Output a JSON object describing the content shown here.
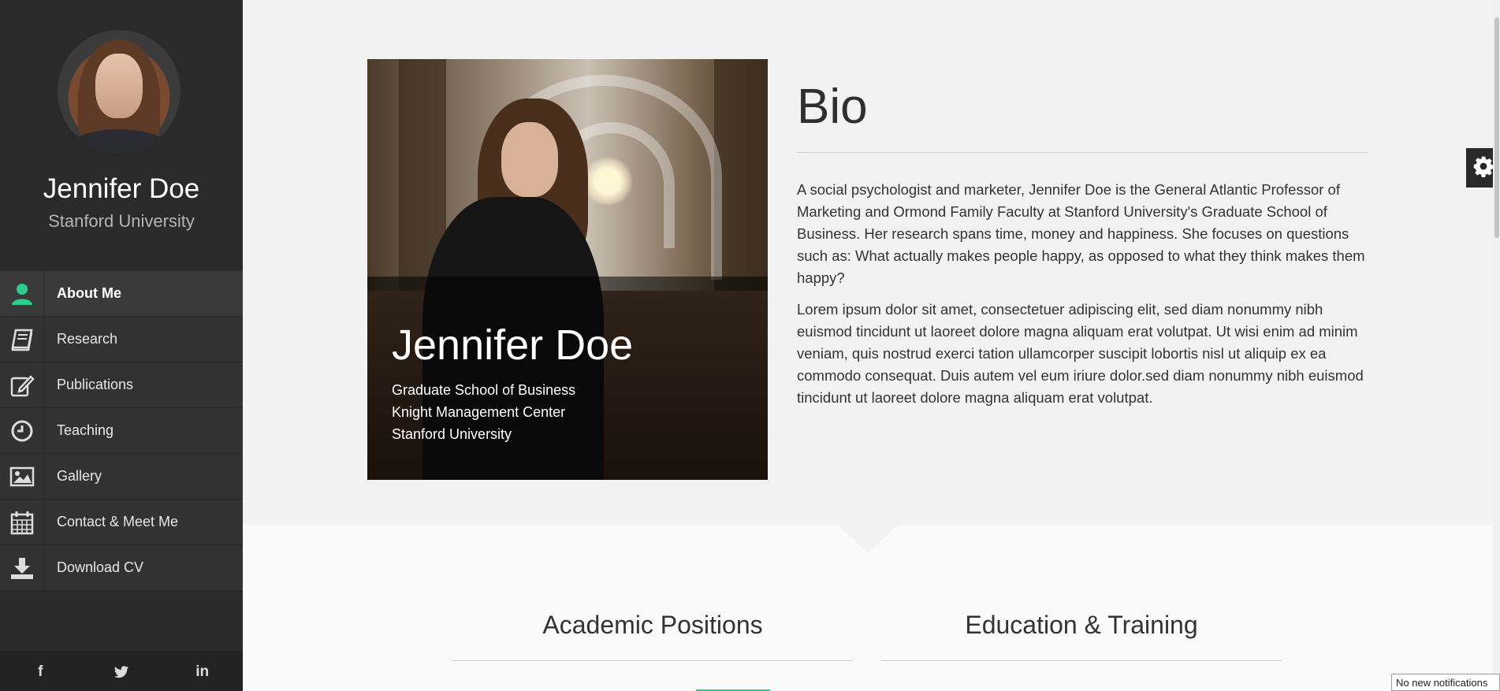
{
  "sidebar": {
    "name": "Jennifer Doe",
    "university": "Stanford University",
    "nav": [
      {
        "label": "About Me",
        "icon": "user-icon",
        "active": true
      },
      {
        "label": "Research",
        "icon": "book-icon"
      },
      {
        "label": "Publications",
        "icon": "edit-icon"
      },
      {
        "label": "Teaching",
        "icon": "clock-icon"
      },
      {
        "label": "Gallery",
        "icon": "image-icon"
      },
      {
        "label": "Contact & Meet Me",
        "icon": "calendar-icon"
      },
      {
        "label": "Download CV",
        "icon": "download-icon"
      }
    ],
    "social": [
      {
        "label": "f",
        "icon": "facebook-icon"
      },
      {
        "label": "🐦",
        "icon": "twitter-icon"
      },
      {
        "label": "in",
        "icon": "linkedin-icon"
      }
    ]
  },
  "profile_card": {
    "name": "Jennifer Doe",
    "lines": [
      "Graduate School of Business",
      "Knight Management Center",
      "Stanford University"
    ]
  },
  "bio": {
    "title": "Bio",
    "paragraphs": [
      "A social psychologist and marketer, Jennifer Doe is the General Atlantic Professor of Marketing and Ormond Family Faculty at Stanford University's Graduate School of Business. Her research spans time, money and happiness. She focuses on questions such as: What actually makes people happy, as opposed to what they think makes them happy?",
      "Lorem ipsum dolor sit amet, consectetuer adipiscing elit, sed diam nonummy nibh euismod tincidunt ut laoreet dolore magna aliquam erat volutpat. Ut wisi enim ad minim veniam, quis nostrud exerci tation ullamcorper suscipit lobortis nisl ut aliquip ex ea commodo consequat. Duis autem vel eum iriure dolor.sed diam nonummy nibh euismod tincidunt ut laoreet dolore magna aliquam erat volutpat."
    ]
  },
  "sections": {
    "academic_positions": "Academic Positions",
    "education_training": "Education & Training"
  },
  "notification": "No new notifications",
  "colors": {
    "sidebar_bg": "#2a2a2a",
    "accent": "#2ecc8a",
    "page_bg": "#f2f2f2"
  }
}
